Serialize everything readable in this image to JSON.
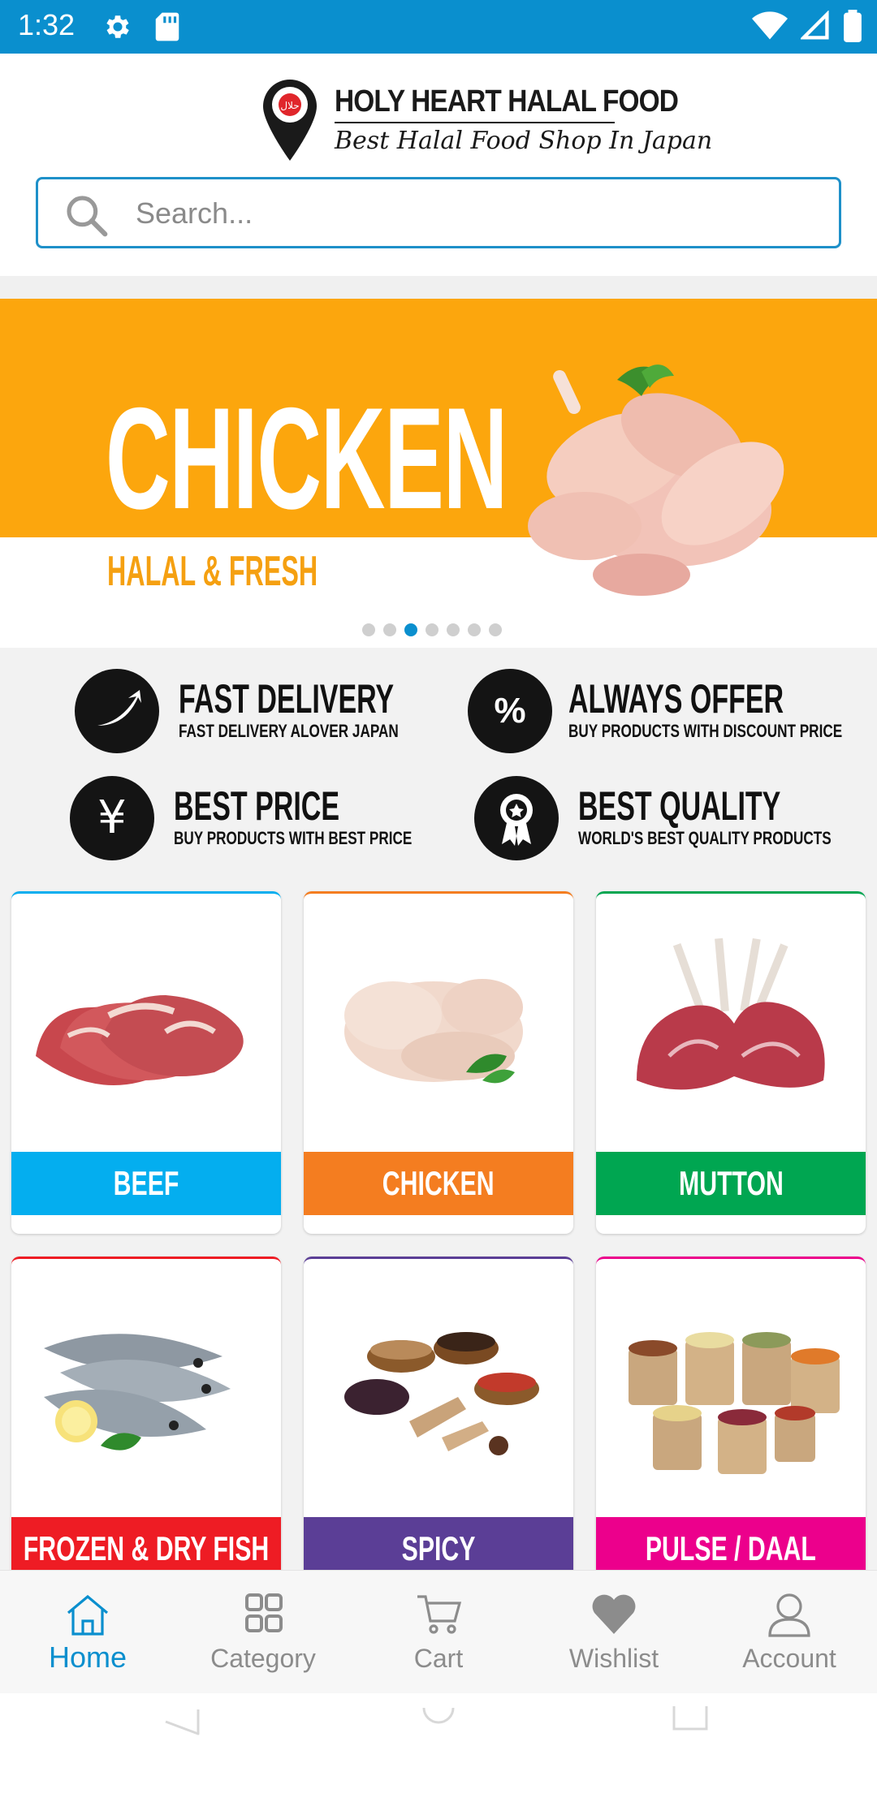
{
  "status_bar": {
    "time": "1:32",
    "icons": [
      "gear-icon",
      "sd-card-icon",
      "wifi-icon",
      "signal-icon",
      "battery-icon"
    ]
  },
  "header": {
    "logo_title": "HOLY HEART HALAL FOOD",
    "logo_tagline": "Best Halal Food Shop In Japan",
    "logo_badge": "حلال"
  },
  "search": {
    "placeholder": "Search..."
  },
  "banner": {
    "headline": "CHICKEN",
    "subline": "HALAL & FRESH",
    "slide_count": 7,
    "active_slide": 3,
    "accent_color": "#fca60d"
  },
  "features": [
    {
      "title": "FAST DELIVERY",
      "subtitle": "FAST DELIVERY ALOVER JAPAN",
      "icon": "delivery-swoosh-icon"
    },
    {
      "title": "ALWAYS OFFER",
      "subtitle": "BUY PRODUCTS WITH DISCOUNT PRICE",
      "icon": "percent-icon"
    },
    {
      "title": "BEST PRICE",
      "subtitle": "BUY PRODUCTS WITH BEST PRICE",
      "icon": "yen-icon"
    },
    {
      "title": "BEST QUALITY",
      "subtitle": "WORLD'S BEST QUALITY PRODUCTS",
      "icon": "ribbon-badge-icon"
    }
  ],
  "categories": [
    {
      "label": "BEEF",
      "color": "#04aeef"
    },
    {
      "label": "CHICKEN",
      "color": "#f47d20"
    },
    {
      "label": "MUTTON",
      "color": "#00a651"
    },
    {
      "label": "FROZEN & DRY FISH",
      "color": "#ee1c24"
    },
    {
      "label": "SPICY",
      "color": "#5b3e96"
    },
    {
      "label": "PULSE / DAAL",
      "color": "#ec008c"
    }
  ],
  "bottom_nav": {
    "items": [
      {
        "label": "Home",
        "icon": "home-icon",
        "active": true
      },
      {
        "label": "Category",
        "icon": "grid-icon",
        "active": false
      },
      {
        "label": "Cart",
        "icon": "cart-icon",
        "active": false
      },
      {
        "label": "Wishlist",
        "icon": "heart-icon",
        "active": false
      },
      {
        "label": "Account",
        "icon": "person-icon",
        "active": false
      }
    ],
    "active_color": "#0a8fce"
  }
}
